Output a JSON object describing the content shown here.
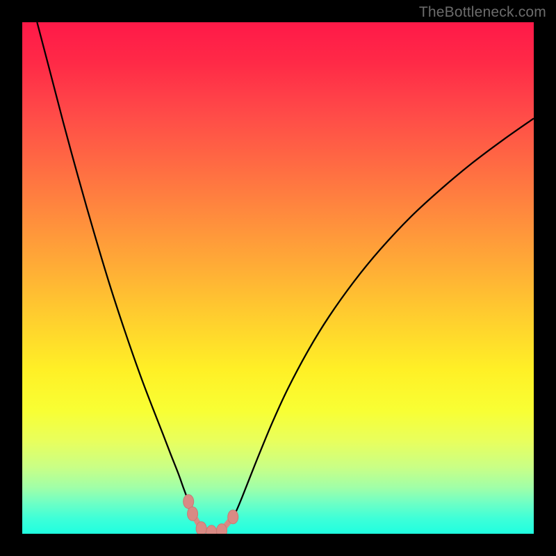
{
  "watermark": "TheBottleneck.com",
  "chart_data": {
    "type": "line",
    "title": "",
    "xlabel": "",
    "ylabel": "",
    "xlim": [
      0,
      100
    ],
    "ylim": [
      0,
      100
    ],
    "grid": false,
    "legend": false,
    "note": "Values are estimated from pixel positions; axes are unlabeled in the source image. y≈0 means green (good), y≈100 means red (bad).",
    "curve": [
      {
        "x": 2.9,
        "y": 100.0
      },
      {
        "x": 5.0,
        "y": 92.0
      },
      {
        "x": 8.0,
        "y": 80.5
      },
      {
        "x": 11.0,
        "y": 69.5
      },
      {
        "x": 14.0,
        "y": 59.0
      },
      {
        "x": 17.0,
        "y": 49.0
      },
      {
        "x": 20.0,
        "y": 39.8
      },
      {
        "x": 23.0,
        "y": 31.2
      },
      {
        "x": 25.5,
        "y": 24.6
      },
      {
        "x": 27.5,
        "y": 19.5
      },
      {
        "x": 29.0,
        "y": 15.6
      },
      {
        "x": 30.5,
        "y": 11.8
      },
      {
        "x": 31.5,
        "y": 9.0
      },
      {
        "x": 32.5,
        "y": 6.3
      },
      {
        "x": 33.3,
        "y": 3.9
      },
      {
        "x": 34.2,
        "y": 2.2
      },
      {
        "x": 35.5,
        "y": 0.9
      },
      {
        "x": 37.0,
        "y": 0.3
      },
      {
        "x": 38.5,
        "y": 0.4
      },
      {
        "x": 40.0,
        "y": 1.3
      },
      {
        "x": 41.0,
        "y": 2.8
      },
      {
        "x": 42.0,
        "y": 4.8
      },
      {
        "x": 43.0,
        "y": 7.2
      },
      {
        "x": 44.5,
        "y": 11.0
      },
      {
        "x": 46.5,
        "y": 16.0
      },
      {
        "x": 49.0,
        "y": 22.0
      },
      {
        "x": 52.0,
        "y": 28.5
      },
      {
        "x": 56.0,
        "y": 36.0
      },
      {
        "x": 60.0,
        "y": 42.5
      },
      {
        "x": 65.0,
        "y": 49.5
      },
      {
        "x": 70.0,
        "y": 55.6
      },
      {
        "x": 76.0,
        "y": 62.0
      },
      {
        "x": 82.0,
        "y": 67.5
      },
      {
        "x": 88.0,
        "y": 72.5
      },
      {
        "x": 94.0,
        "y": 77.0
      },
      {
        "x": 100.0,
        "y": 81.2
      }
    ],
    "markers": [
      {
        "x": 32.5,
        "y": 6.3
      },
      {
        "x": 33.3,
        "y": 3.9
      },
      {
        "x": 35.0,
        "y": 1.0
      },
      {
        "x": 37.0,
        "y": 0.3
      },
      {
        "x": 39.0,
        "y": 0.6
      },
      {
        "x": 41.2,
        "y": 3.3
      }
    ],
    "marker_color": "#d98a84"
  }
}
